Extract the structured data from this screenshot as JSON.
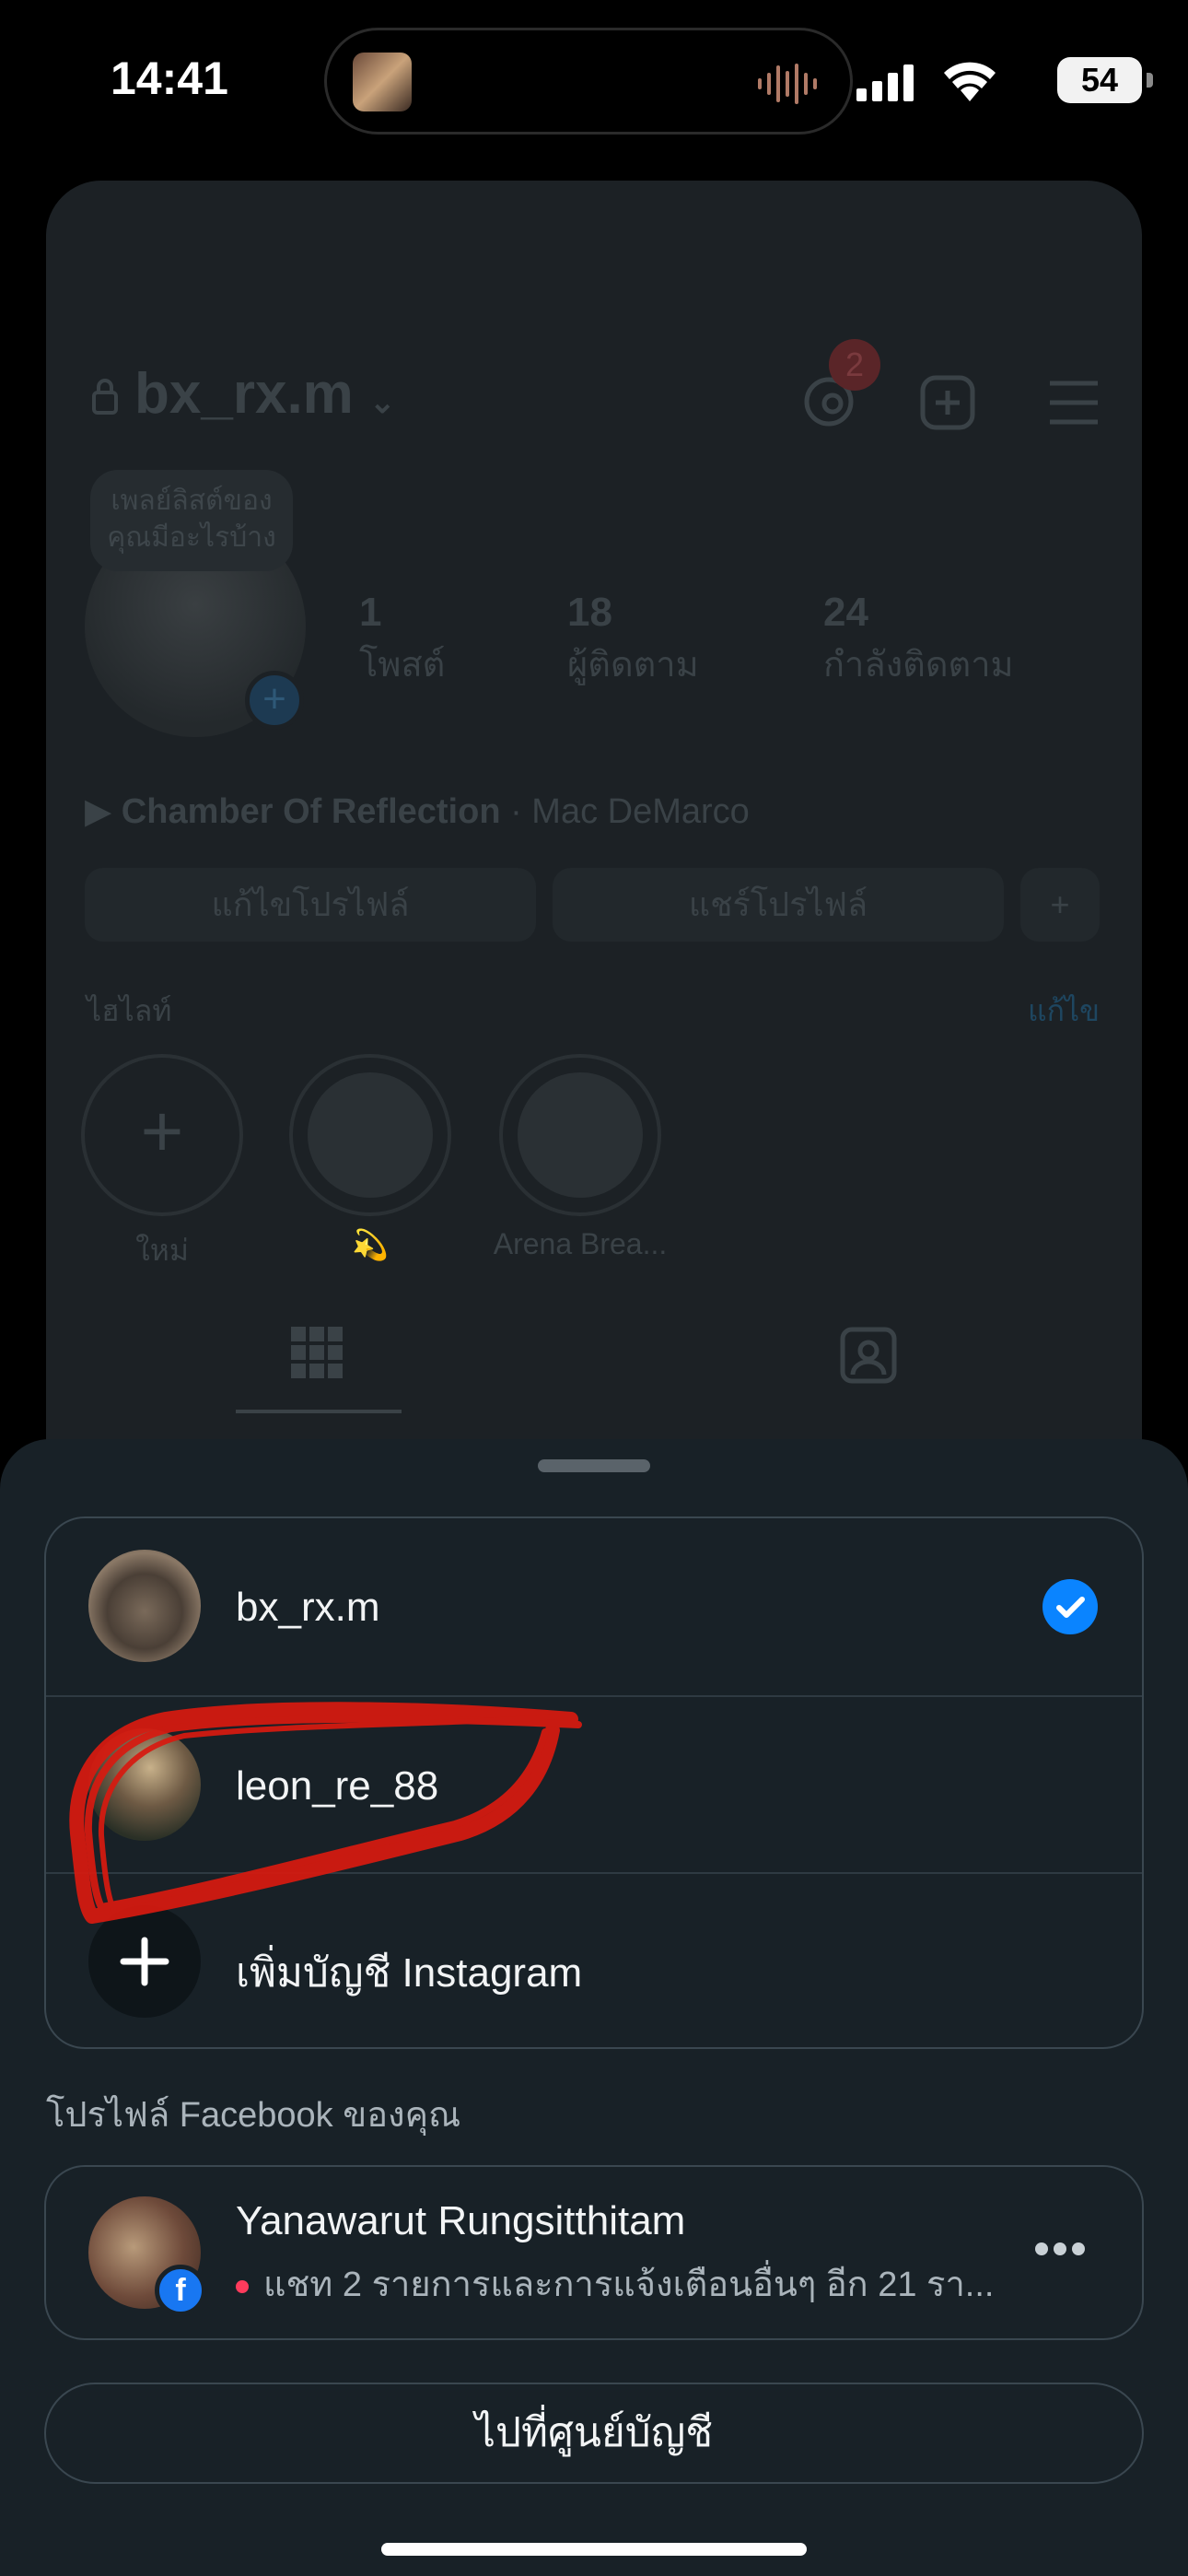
{
  "status_bar": {
    "time": "14:41",
    "battery": "54"
  },
  "background_profile": {
    "username": "bx_rx.m",
    "notification_count": "2",
    "note": "เพลย์ลิสต์ของคุณมีอะไรบ้าง",
    "stats": [
      {
        "value": "1",
        "label": "โพสต์"
      },
      {
        "value": "18",
        "label": "ผู้ติดตาม"
      },
      {
        "value": "24",
        "label": "กำลังติดตาม"
      }
    ],
    "song_title": "Chamber Of Reflection",
    "song_artist": "· Mac DeMarco",
    "edit_profile": "แก้ไขโปรไฟล์",
    "share_profile": "แชร์โปรไฟล์",
    "highlights_label": "ไฮไลท์",
    "highlights_edit": "แก้ไข",
    "highlights": [
      {
        "label": "ใหม่"
      },
      {
        "label": "💫"
      },
      {
        "label": "Arena Brea..."
      }
    ]
  },
  "account_sheet": {
    "accounts": [
      {
        "username": "bx_rx.m",
        "selected": true
      },
      {
        "username": "leon_re_88",
        "selected": false
      }
    ],
    "add_account": "เพิ่มบัญชี Instagram",
    "facebook_section_label": "โปรไฟล์ Facebook ของคุณ",
    "facebook_profile": {
      "name": "Yanawarut Rungsitthitam",
      "subtitle": "แชท 2 รายการและการแจ้งเตือนอื่นๆ อีก 21 รา..."
    },
    "accounts_center_button": "ไปที่ศูนย์บัญชี"
  },
  "colors": {
    "sheet_bg": "#182127",
    "check_blue": "#0a84ff",
    "facebook_blue": "#1877f2",
    "annotation_red": "#d81a10"
  }
}
